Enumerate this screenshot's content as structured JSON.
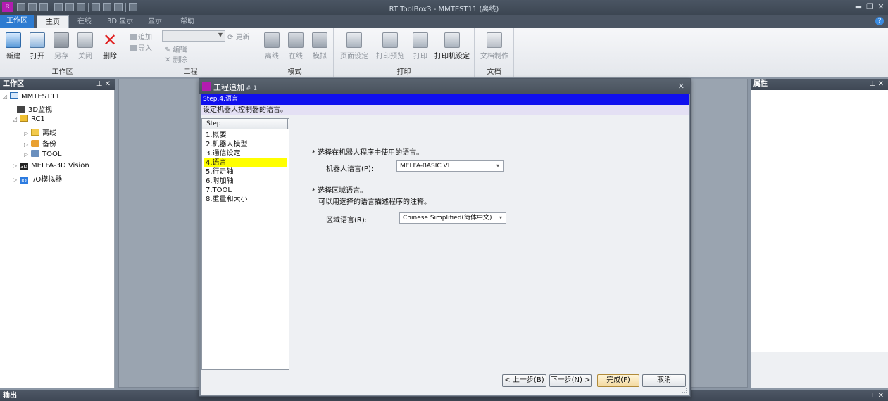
{
  "window": {
    "title": "RT ToolBox3 - MMTEST11 (离线)",
    "app_icon": "rt-toolbox-icon",
    "minimize": "▬",
    "restore": "❐",
    "close": "✕"
  },
  "tabs": {
    "workspace": "工作区",
    "home": "主页",
    "online": "在线",
    "display3d": "3D 显示",
    "display": "显示",
    "help": "帮助",
    "help_icon": "?"
  },
  "ribbon": {
    "workspace_group": {
      "label": "工作区",
      "new": "新建",
      "open": "打开",
      "save_as": "另存",
      "close": "关闭",
      "delete": "删除"
    },
    "project_group": {
      "label": "工程",
      "add": "追加",
      "import": "导入",
      "edit": "编辑",
      "delete": "删除",
      "refresh": "更新",
      "select_value": ""
    },
    "mode_group": {
      "label": "模式",
      "offline": "离线",
      "online": "在线",
      "simulate": "模拟"
    },
    "print_group": {
      "label": "打印",
      "page_setup": "页面设定",
      "print_preview": "打印预览",
      "print": "打印",
      "printer_setup": "打印机设定"
    },
    "doc_group": {
      "label": "文档",
      "create_doc": "文档制作"
    }
  },
  "workspace_panel": {
    "title": "工作区",
    "pin": "⊥ ✕",
    "tree": [
      {
        "label": "MMTEST11",
        "icon": "project-icon"
      },
      {
        "label": "3D监视",
        "icon": "3d-monitor-icon"
      },
      {
        "label": "RC1",
        "icon": "robot-controller-icon"
      },
      {
        "label": "离线",
        "icon": "folder-icon"
      },
      {
        "label": "备份",
        "icon": "backup-icon"
      },
      {
        "label": "TOOL",
        "icon": "tool-icon"
      },
      {
        "label": "MELFA-3D Vision",
        "icon": "vision-icon",
        "badge": "3D"
      },
      {
        "label": "I/O模拟器",
        "icon": "io-simulator-icon",
        "badge": "IO"
      }
    ]
  },
  "properties_panel": {
    "title": "属性",
    "pin": "⊥ ✕"
  },
  "output_panel": {
    "title": "输出",
    "pin": "⊥ ✕"
  },
  "dialog": {
    "title": "工程追加",
    "title_num": "# 1",
    "close": "✕",
    "step_bar": "Step.4.语言",
    "step_desc": "设定机器人控制器的语言。",
    "step_header": "Step",
    "steps": [
      "1.概要",
      "2.机器人模型",
      "3.通信设定",
      "4.语言",
      "5.行走轴",
      "6.附加轴",
      "7.TOOL",
      "8.重量和大小"
    ],
    "active_step": 3,
    "q1": "* 选择在机器人程序中使用的语言。",
    "robot_lang_label": "机器人语言(P):",
    "robot_lang_value": "MELFA-BASIC VI",
    "q2": "* 选择区域语言。",
    "q2_sub": "可以用选择的语言描述程序的注释。",
    "region_lang_label": "区域语言(R):",
    "region_lang_value": "Chinese Simplified(简体中文)",
    "buttons": {
      "prev": "< 上一步(B)",
      "next": "下一步(N) >",
      "finish": "完成(F)",
      "cancel": "取消"
    }
  }
}
